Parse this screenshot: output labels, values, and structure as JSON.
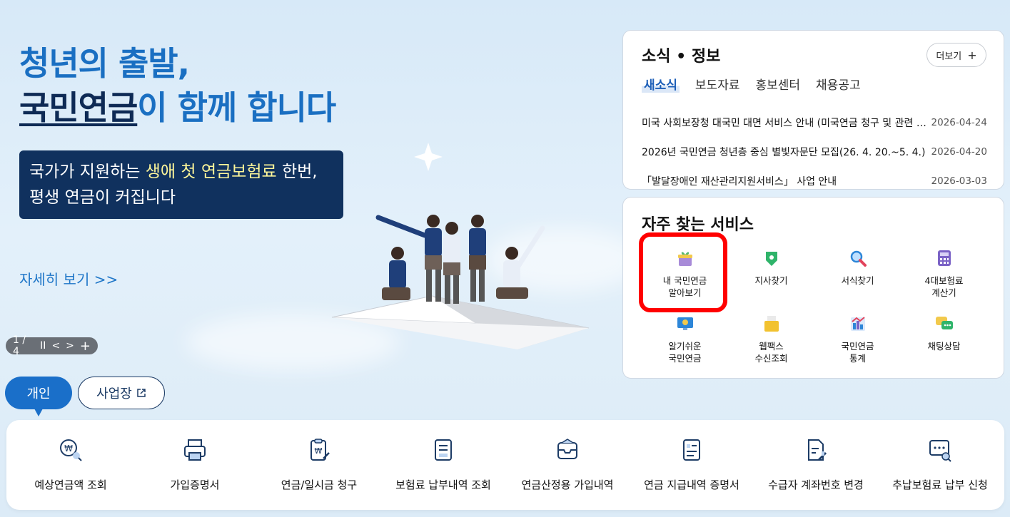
{
  "hero": {
    "title_line1": "청년의 출발,",
    "title_line2_dark": "국민연금",
    "title_line2_rest": "이 함께 합니다",
    "box_pre": "국가가 지원하는 ",
    "box_highlight": "생애 첫 연금보험료",
    "box_post": " 한번,",
    "box_line2": "평생 연금이 커집니다",
    "more_link": "자세히 보기 >>"
  },
  "slider": {
    "counter": "1 / 4",
    "pause": "II",
    "prev": "<",
    "next": ">",
    "add": "+"
  },
  "tabs": {
    "personal": "개인",
    "business": "사업장"
  },
  "news": {
    "title": "소식 • 정보",
    "more": "더보기",
    "tabs": [
      "새소식",
      "보도자료",
      "홍보센터",
      "채용공고"
    ],
    "items": [
      {
        "title": "미국 사회보장청 대국민 대면 서비스 안내 (미국연금 청구 및 관련 민원)",
        "date": "2026-04-24"
      },
      {
        "title": "2026년 국민연금 청년층 중심 별빛자문단 모집(26. 4. 20.~5. 4.)",
        "date": "2026-04-20"
      },
      {
        "title": "「발달장애인 재산관리지원서비스」 사업 안내",
        "date": "2026-03-03"
      }
    ]
  },
  "services": {
    "title": "자주 찾는 서비스",
    "items": [
      {
        "line1": "내 국민연금",
        "line2": "알아보기",
        "icon": "gift-icon"
      },
      {
        "line1": "지사찾기",
        "line2": "",
        "icon": "map-pin-icon"
      },
      {
        "line1": "서식찾기",
        "line2": "",
        "icon": "magnifier-icon"
      },
      {
        "line1": "4대보험료",
        "line2": "계산기",
        "icon": "calculator-icon"
      },
      {
        "line1": "알기쉬운",
        "line2": "국민연금",
        "icon": "monitor-icon"
      },
      {
        "line1": "웹팩스",
        "line2": "수신조회",
        "icon": "fax-icon"
      },
      {
        "line1": "국민연금",
        "line2": "통계",
        "icon": "chart-icon"
      },
      {
        "line1": "채팅상담",
        "line2": "",
        "icon": "chat-icon"
      }
    ]
  },
  "bottom_menu": [
    {
      "label": "예상연금액 조회",
      "icon": "won-search-icon"
    },
    {
      "label": "가입증명서",
      "icon": "printer-icon"
    },
    {
      "label": "연금/일시금 청구",
      "icon": "clipboard-won-icon"
    },
    {
      "label": "보험료 납부내역 조회",
      "icon": "document-list-icon"
    },
    {
      "label": "연금산정용 가입내역",
      "icon": "inbox-icon"
    },
    {
      "label": "연금 지급내역 증명서",
      "icon": "certificate-icon"
    },
    {
      "label": "수급자 계좌번호 변경",
      "icon": "document-edit-icon"
    },
    {
      "label": "추납보험료 납부 신청",
      "icon": "screen-search-icon"
    }
  ]
}
